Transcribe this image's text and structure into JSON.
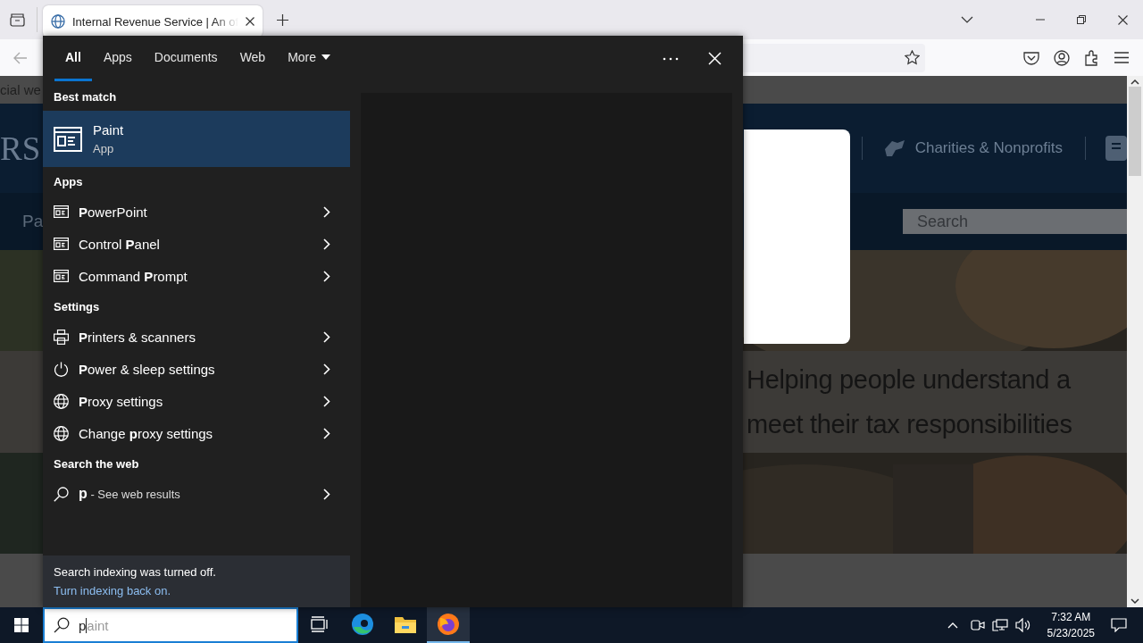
{
  "browser": {
    "tabs": [
      {
        "title": "Internal Revenue Service | An of",
        "selected": true
      }
    ],
    "page": {
      "top_bar_text": "cial we",
      "logo_text": "RS",
      "header_links": [
        {
          "label": "Charities & Nonprofits"
        }
      ],
      "nav_text": "Pa",
      "search": {
        "placeholder": "Search"
      },
      "headline": [
        "Helping people understand a",
        "meet their tax responsibilities"
      ]
    }
  },
  "search_panel": {
    "tabs": [
      {
        "label": "All",
        "selected": true,
        "kind": "plain"
      },
      {
        "label": "Apps",
        "selected": false,
        "kind": "plain"
      },
      {
        "label": "Documents",
        "selected": false,
        "kind": "plain"
      },
      {
        "label": "Web",
        "selected": false,
        "kind": "plain"
      },
      {
        "label": "More",
        "selected": false,
        "kind": "menu"
      }
    ],
    "best_match": {
      "heading": "Best match",
      "title": "Paint",
      "subtitle": "App",
      "selected": true
    },
    "sections": [
      {
        "heading": "Apps",
        "items": [
          {
            "label": "**P**owerPoint",
            "kind": "app"
          },
          {
            "label": "Control **P**anel",
            "kind": "app"
          },
          {
            "label": "Command **P**rompt",
            "kind": "app"
          }
        ]
      },
      {
        "heading": "Settings",
        "items": [
          {
            "label": "**P**rinters & scanners",
            "kind": "printer"
          },
          {
            "label": "**P**ower & sleep settings",
            "kind": "power"
          },
          {
            "label": "**P**roxy settings",
            "kind": "globe"
          },
          {
            "label": "Change **p**roxy settings",
            "kind": "globe"
          }
        ]
      },
      {
        "heading": "Search the web",
        "items": [
          {
            "label": "**p** - See web results",
            "kind": "web"
          }
        ]
      }
    ],
    "notice": {
      "text": "Search indexing was turned off.",
      "link": "Turn indexing back on."
    }
  },
  "taskbar": {
    "search": {
      "value": "p",
      "completion": "aint"
    },
    "apps": [
      {
        "kind": "task-view",
        "selected": false
      },
      {
        "kind": "edge",
        "selected": false
      },
      {
        "kind": "explorer",
        "selected": false
      },
      {
        "kind": "firefox",
        "selected": true
      }
    ],
    "clock": {
      "time": "7:32 AM",
      "date": "5/23/2025"
    }
  }
}
